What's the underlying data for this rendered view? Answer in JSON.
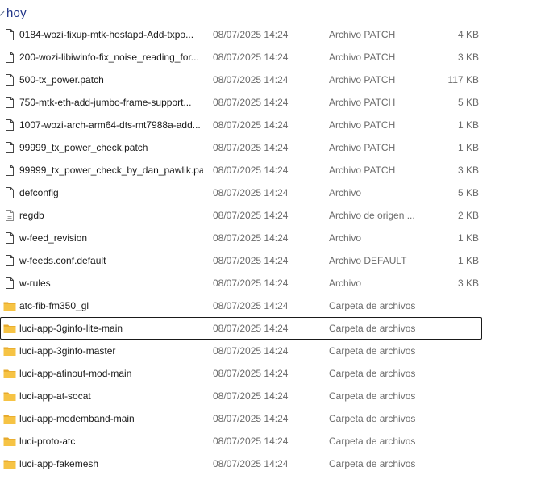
{
  "group": {
    "title": "hoy"
  },
  "files": [
    {
      "name": "0184-wozi-fixup-mtk-hostapd-Add-txpo...",
      "date": "08/07/2025 14:24",
      "type": "Archivo PATCH",
      "size": "4 KB",
      "icon": "file-icon",
      "selected": false
    },
    {
      "name": "200-wozi-libiwinfo-fix_noise_reading_for...",
      "date": "08/07/2025 14:24",
      "type": "Archivo PATCH",
      "size": "3 KB",
      "icon": "file-icon",
      "selected": false
    },
    {
      "name": "500-tx_power.patch",
      "date": "08/07/2025 14:24",
      "type": "Archivo PATCH",
      "size": "117 KB",
      "icon": "file-icon",
      "selected": false
    },
    {
      "name": "750-mtk-eth-add-jumbo-frame-support...",
      "date": "08/07/2025 14:24",
      "type": "Archivo PATCH",
      "size": "5 KB",
      "icon": "file-icon",
      "selected": false
    },
    {
      "name": "1007-wozi-arch-arm64-dts-mt7988a-add...",
      "date": "08/07/2025 14:24",
      "type": "Archivo PATCH",
      "size": "1 KB",
      "icon": "file-icon",
      "selected": false
    },
    {
      "name": "99999_tx_power_check.patch",
      "date": "08/07/2025 14:24",
      "type": "Archivo PATCH",
      "size": "1 KB",
      "icon": "file-icon",
      "selected": false
    },
    {
      "name": "99999_tx_power_check_by_dan_pawlik.pa...",
      "date": "08/07/2025 14:24",
      "type": "Archivo PATCH",
      "size": "3 KB",
      "icon": "file-icon",
      "selected": false
    },
    {
      "name": "defconfig",
      "date": "08/07/2025 14:24",
      "type": "Archivo",
      "size": "5 KB",
      "icon": "file-icon",
      "selected": false
    },
    {
      "name": "regdb",
      "date": "08/07/2025 14:24",
      "type": "Archivo de origen ...",
      "size": "2 KB",
      "icon": "text-file-icon",
      "selected": false
    },
    {
      "name": "w-feed_revision",
      "date": "08/07/2025 14:24",
      "type": "Archivo",
      "size": "1 KB",
      "icon": "file-icon",
      "selected": false
    },
    {
      "name": "w-feeds.conf.default",
      "date": "08/07/2025 14:24",
      "type": "Archivo DEFAULT",
      "size": "1 KB",
      "icon": "file-icon",
      "selected": false
    },
    {
      "name": "w-rules",
      "date": "08/07/2025 14:24",
      "type": "Archivo",
      "size": "3 KB",
      "icon": "file-icon",
      "selected": false
    },
    {
      "name": "atc-fib-fm350_gl",
      "date": "08/07/2025 14:24",
      "type": "Carpeta de archivos",
      "size": "",
      "icon": "folder-icon",
      "selected": false
    },
    {
      "name": "luci-app-3ginfo-lite-main",
      "date": "08/07/2025 14:24",
      "type": "Carpeta de archivos",
      "size": "",
      "icon": "folder-icon",
      "selected": true
    },
    {
      "name": "luci-app-3ginfo-master",
      "date": "08/07/2025 14:24",
      "type": "Carpeta de archivos",
      "size": "",
      "icon": "folder-icon",
      "selected": false
    },
    {
      "name": "luci-app-atinout-mod-main",
      "date": "08/07/2025 14:24",
      "type": "Carpeta de archivos",
      "size": "",
      "icon": "folder-icon",
      "selected": false
    },
    {
      "name": "luci-app-at-socat",
      "date": "08/07/2025 14:24",
      "type": "Carpeta de archivos",
      "size": "",
      "icon": "folder-icon",
      "selected": false
    },
    {
      "name": "luci-app-modemband-main",
      "date": "08/07/2025 14:24",
      "type": "Carpeta de archivos",
      "size": "",
      "icon": "folder-icon",
      "selected": false
    },
    {
      "name": "luci-proto-atc",
      "date": "08/07/2025 14:24",
      "type": "Carpeta de archivos",
      "size": "",
      "icon": "folder-icon",
      "selected": false
    },
    {
      "name": "luci-app-fakemesh",
      "date": "08/07/2025 14:24",
      "type": "Carpeta de archivos",
      "size": "",
      "icon": "folder-icon",
      "selected": false
    }
  ],
  "colors": {
    "group_title": "#1e3287",
    "folder_fill": "#f6c344",
    "folder_tab": "#e6a92a",
    "secondary_text": "#6b6b6b",
    "selection_border": "#1a1a1a"
  }
}
